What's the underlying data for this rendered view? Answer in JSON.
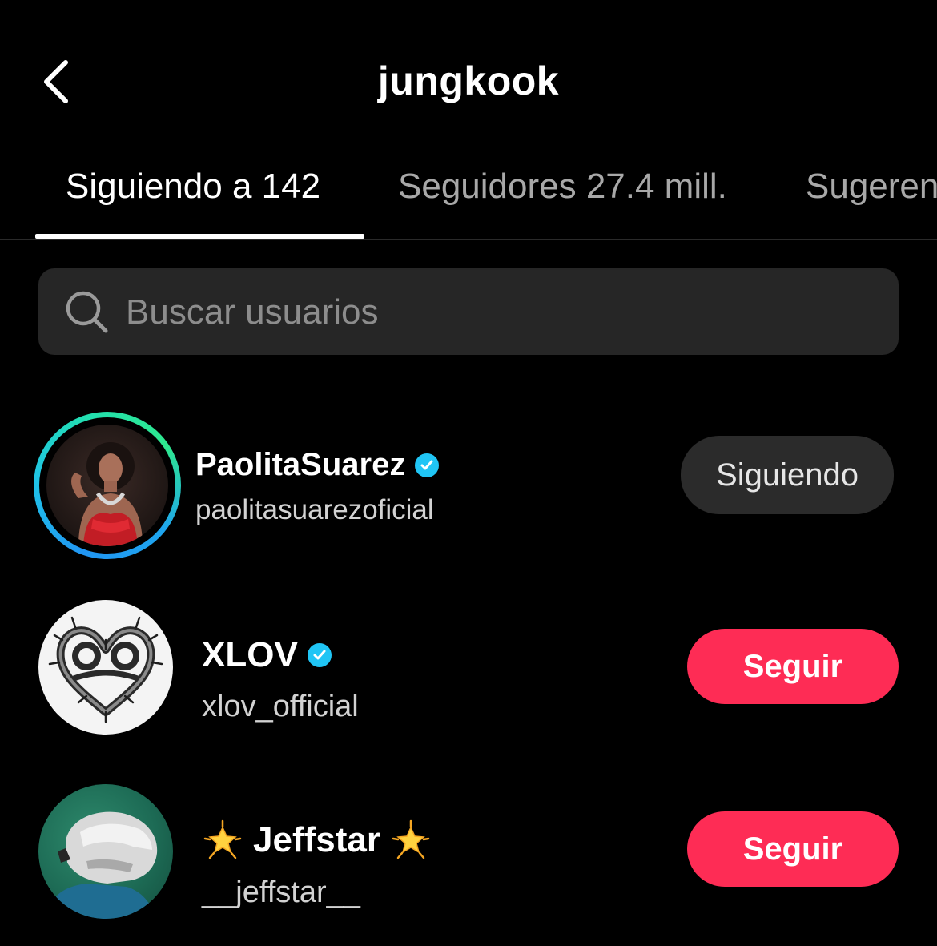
{
  "header": {
    "title": "jungkook",
    "back_icon": "chevron-left-icon"
  },
  "tabs": [
    {
      "label": "Siguiendo a 142",
      "active": true
    },
    {
      "label": "Seguidores 27.4 mill.",
      "active": false
    },
    {
      "label": "Sugeren",
      "active": false
    }
  ],
  "search": {
    "placeholder": "Buscar usuarios",
    "value": "",
    "icon": "search-icon"
  },
  "users": [
    {
      "display_name": "PaolitaSuarez",
      "username": "paolitasuarezoficial",
      "verified": true,
      "has_story_ring": true,
      "button_label": "Siguiendo",
      "button_state": "following"
    },
    {
      "display_name": "XLOV",
      "username": "xlov_official",
      "verified": true,
      "has_story_ring": false,
      "button_label": "Seguir",
      "button_state": "follow"
    },
    {
      "display_name": "Jeffstar",
      "name_decoration": "glowing-star-icon",
      "username": "__jeffstar__",
      "verified": false,
      "has_story_ring": false,
      "button_label": "Seguir",
      "button_state": "follow"
    }
  ],
  "colors": {
    "background": "#000000",
    "follow_button": "#fe2c55",
    "following_button": "#2b2b2b",
    "verified_badge": "#20c5f5",
    "search_background": "#262626",
    "inactive_tab": "#a8a8a8"
  }
}
